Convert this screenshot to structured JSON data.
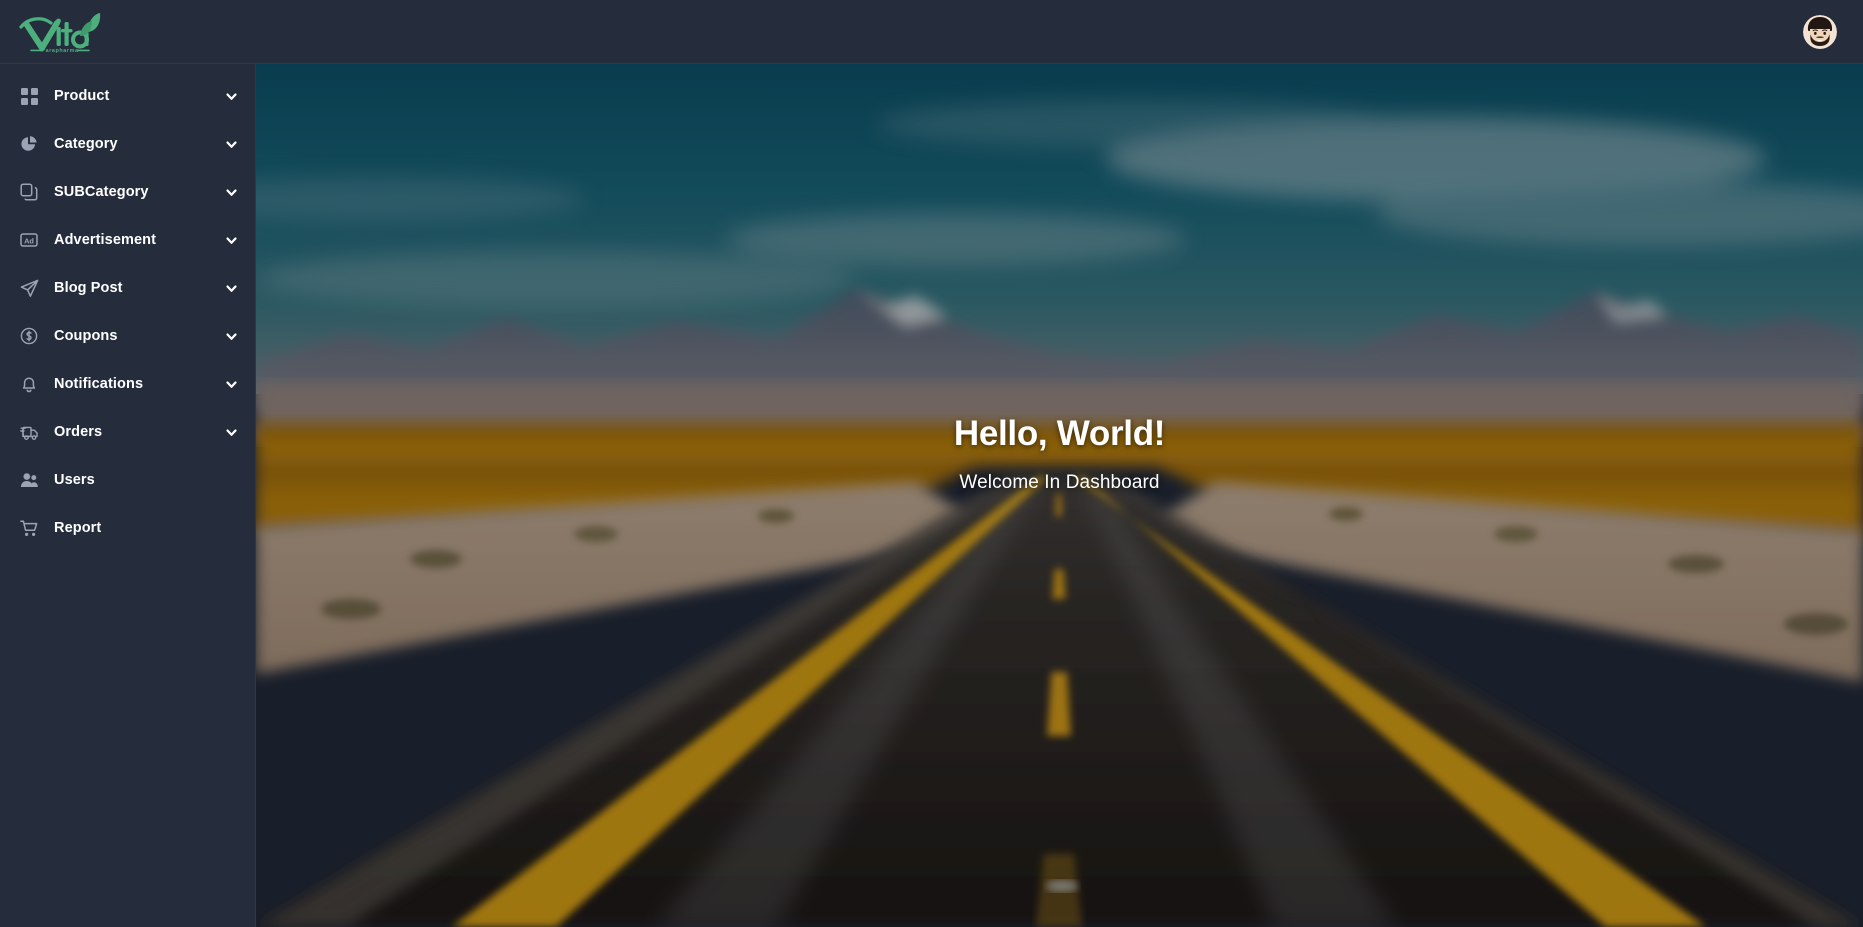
{
  "brand": {
    "name": "Vita",
    "tagline": "Parapharma",
    "logo_color": "#4caf7d"
  },
  "header": {
    "avatar_alt": "user-avatar"
  },
  "sidebar": {
    "items": [
      {
        "label": "Product",
        "icon": "grid-icon",
        "has_chevron": true
      },
      {
        "label": "Category",
        "icon": "pie-chart-icon",
        "has_chevron": true
      },
      {
        "label": "SUBCategory",
        "icon": "layers-copy-icon",
        "has_chevron": true
      },
      {
        "label": "Advertisement",
        "icon": "ad-box-icon",
        "has_chevron": true
      },
      {
        "label": "Blog Post",
        "icon": "paper-plane-icon",
        "has_chevron": true
      },
      {
        "label": "Coupons",
        "icon": "dollar-circle-icon",
        "has_chevron": true
      },
      {
        "label": "Notifications",
        "icon": "bell-icon",
        "has_chevron": true
      },
      {
        "label": "Orders",
        "icon": "truck-icon",
        "has_chevron": true
      },
      {
        "label": "Users",
        "icon": "users-icon",
        "has_chevron": false
      },
      {
        "label": "Report",
        "icon": "shopping-cart-icon",
        "has_chevron": false
      }
    ]
  },
  "main": {
    "hero_title": "Hello, World!",
    "hero_subtitle": "Welcome In Dashboard",
    "background_description": "desert highway with mountains"
  },
  "colors": {
    "sidebar_bg": "#252d3d",
    "header_bg": "#252d3d",
    "divider": "#2f384a",
    "label_text": "#ffffff",
    "icon_text": "#9aa4b5",
    "accent_green": "#4caf7d",
    "road_line_yellow": "#e0a41a"
  }
}
